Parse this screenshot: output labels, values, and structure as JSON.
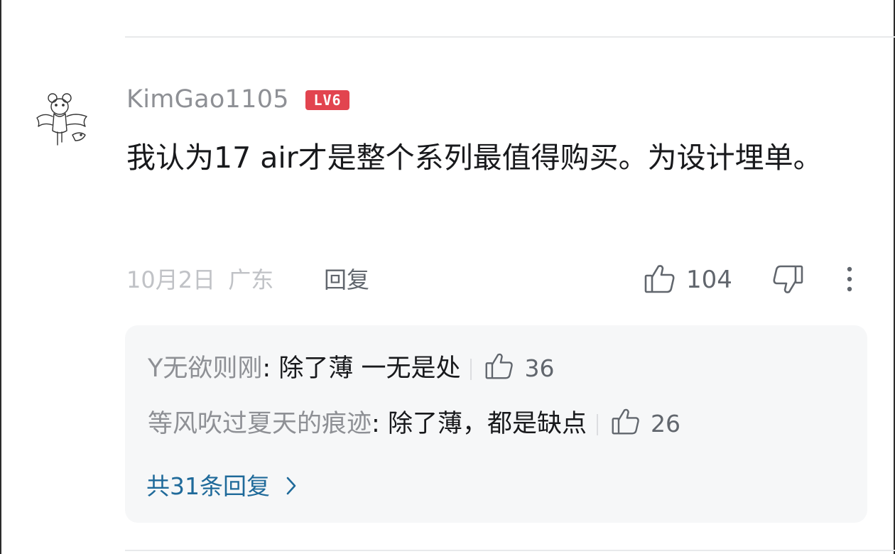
{
  "comment": {
    "username": "KimGao1105",
    "level": "LV6",
    "text": "我认为17 air才是整个系列最值得购买。为设计埋单。",
    "date": "10月2日",
    "location": "广东",
    "reply_label": "回复",
    "like_count": "104"
  },
  "replies": [
    {
      "user": "Y无欲则刚",
      "colon": ": ",
      "text": "除了薄 一无是处",
      "like_count": "36"
    },
    {
      "user": "等风吹过夏天的痕迹",
      "colon": ": ",
      "text": "除了薄，都是缺点",
      "like_count": "26"
    }
  ],
  "more_replies_label": "共31条回复",
  "colors": {
    "username": "#8e9095",
    "level_badge": "#e2444f",
    "link": "#1f6a9a",
    "reply_box_bg": "#f6f7f8"
  },
  "icons": [
    "avatar-bat-illustration",
    "thumbs-up-icon",
    "thumbs-down-icon",
    "more-vertical-icon",
    "chevron-right-icon"
  ]
}
